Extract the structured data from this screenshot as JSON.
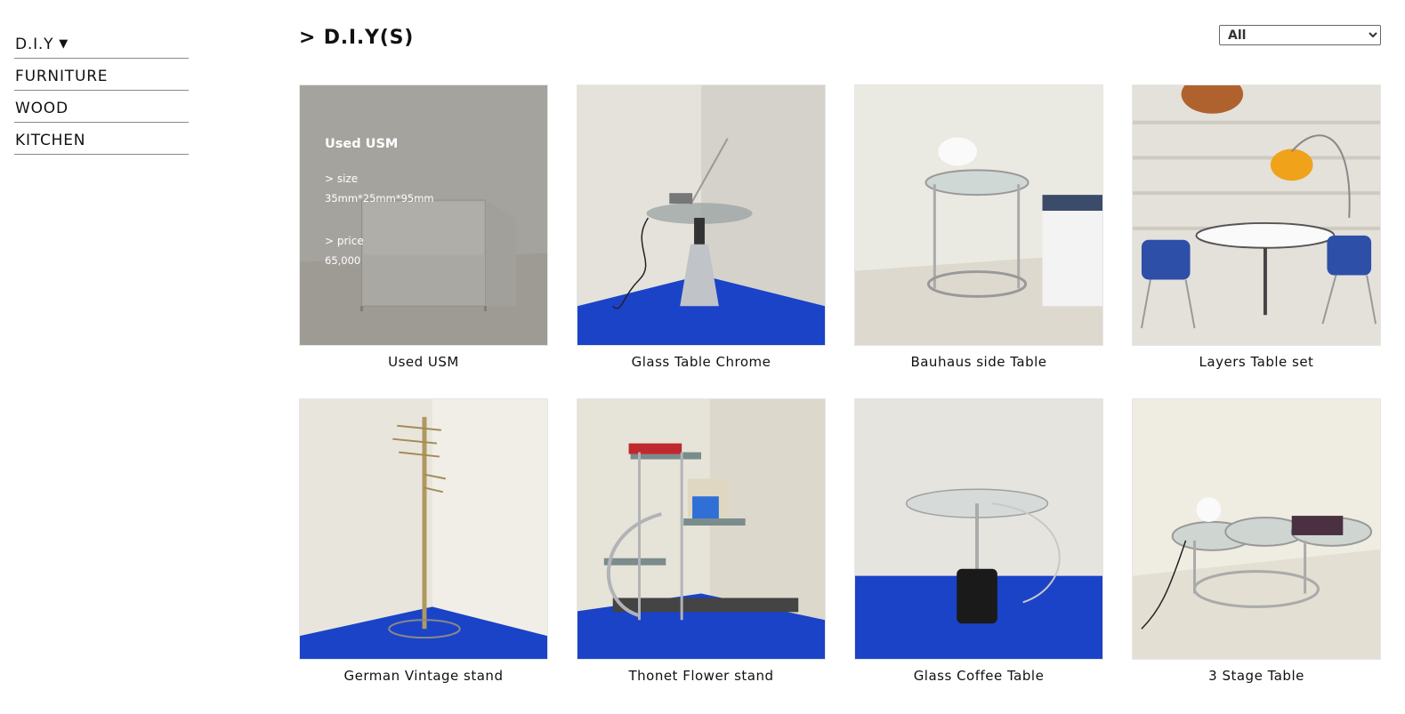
{
  "sidebar": {
    "items": [
      {
        "label": "D.I.Y"
      },
      {
        "label": "FURNITURE"
      },
      {
        "label": "WOOD"
      },
      {
        "label": "KITCHEN"
      }
    ]
  },
  "header": {
    "title": "> D.I.Y(S)",
    "filter_selected": "All"
  },
  "products": [
    {
      "name": "Used USM"
    },
    {
      "name": "Glass Table Chrome"
    },
    {
      "name": "Bauhaus side Table"
    },
    {
      "name": "Layers Table set"
    },
    {
      "name": "German Vintage stand"
    },
    {
      "name": "Thonet Flower stand"
    },
    {
      "name": "Glass Coffee Table"
    },
    {
      "name": "3 Stage Table"
    }
  ],
  "hover_overlay": {
    "title": "Used USM",
    "size_label": "> size",
    "size_value": "35mm*25mm*95mm",
    "price_label": "> price",
    "price_value": "65,000"
  },
  "colors": {
    "carpet_blue": "#1a43c8",
    "wall": "#ecebe4",
    "chrome": "#b9bcc2"
  }
}
